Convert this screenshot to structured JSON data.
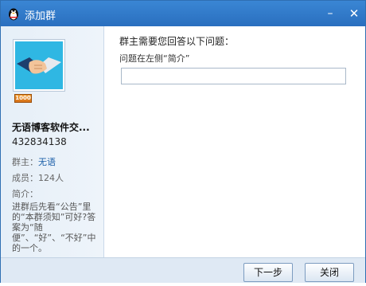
{
  "window": {
    "title": "添加群",
    "min_symbol": "–",
    "close_symbol": "✕"
  },
  "sidebar": {
    "avatar_badge": "1000",
    "group_name": "无语博客软件交...",
    "group_id": "432834138",
    "owner_label": "群主：",
    "owner_value": "无语",
    "members_label": "成员：",
    "members_value": "124人",
    "intro_label": "简介：",
    "intro_text": "进群后先看“公告”里的“本群须知”可好?答案为“随便”、“好”、“不好”中的一个。"
  },
  "content": {
    "question_heading": "群主需要您回答以下问题：",
    "question_text": "问题在左侧“简介”",
    "answer_value": "",
    "answer_placeholder": ""
  },
  "footer": {
    "next_label": "下一步",
    "close_label": "关闭"
  },
  "colors": {
    "titlebar": "#2f78c8",
    "sidebar_bg": "#e8f0f8",
    "footer_bg": "#dfe9f4",
    "link": "#1b5fa8"
  },
  "icons": {
    "app_logo": "penguin-icon",
    "avatar": "handshake-icon"
  }
}
